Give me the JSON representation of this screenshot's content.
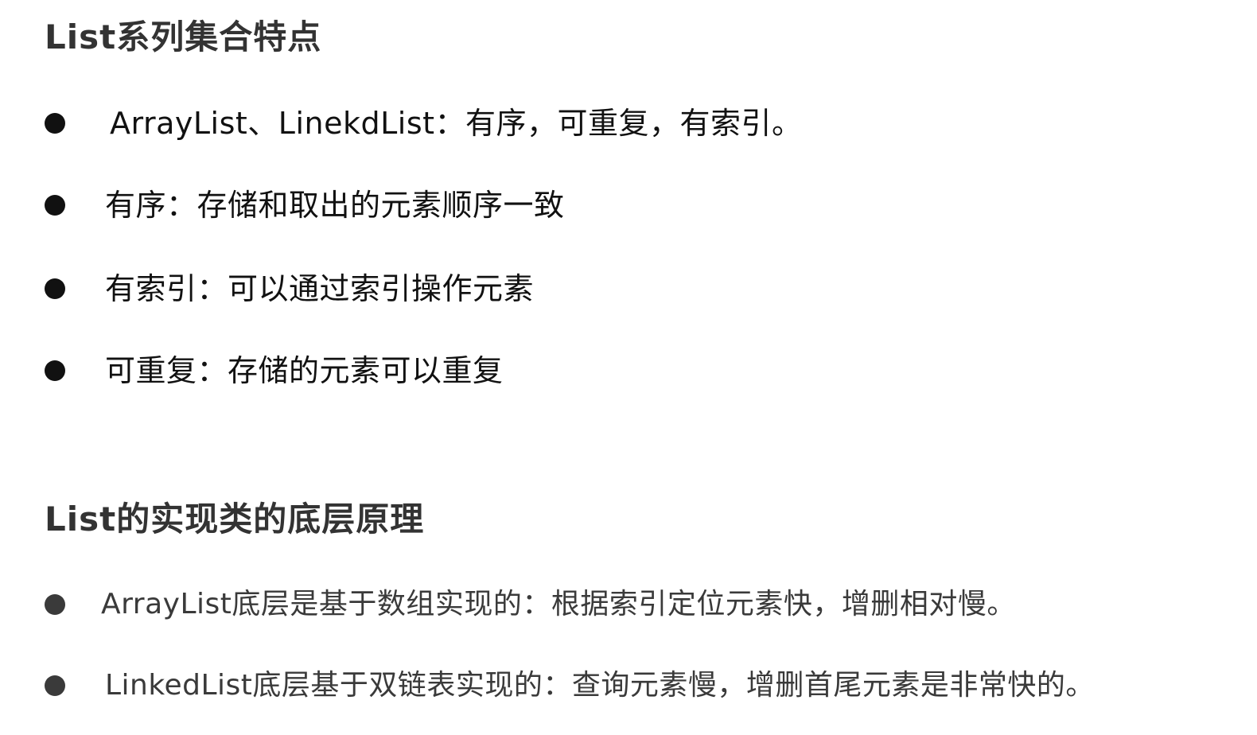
{
  "section_list_features": {
    "title": "List系列集合特点",
    "items": [
      "ArrayList、LinekdList：有序，可重复，有索引。",
      "有序：存储和取出的元素顺序一致",
      "有索引：可以通过索引操作元素",
      "可重复：存储的元素可以重复"
    ]
  },
  "section_implementation": {
    "title": "List的实现类的底层原理",
    "items": [
      "ArrayList底层是基于数组实现的：根据索引定位元素快，增删相对慢。",
      "LinkedList底层基于双链表实现的：查询元素慢，增删首尾元素是非常快的。"
    ]
  }
}
